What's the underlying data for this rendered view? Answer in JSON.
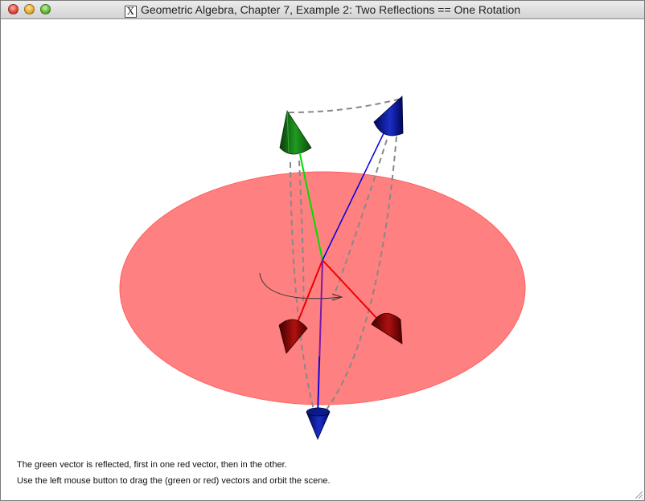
{
  "window": {
    "title": "Geometric Algebra, Chapter 7, Example 2: Two Reflections == One Rotation",
    "title_icon": "x11-icon",
    "buttons": [
      "close",
      "minimize",
      "zoom"
    ]
  },
  "scene": {
    "plane_color": "#ff8080",
    "green_vector_color": "#00cc00",
    "red_vector_color": "#ee0000",
    "blue_vector_color": "#0000dd",
    "guide_line_color": "#888888"
  },
  "help": {
    "line1": "The green vector is reflected, first in one red vector, then in the other.",
    "line2": "Use the left mouse button to drag the (green or red) vectors and orbit the scene."
  }
}
